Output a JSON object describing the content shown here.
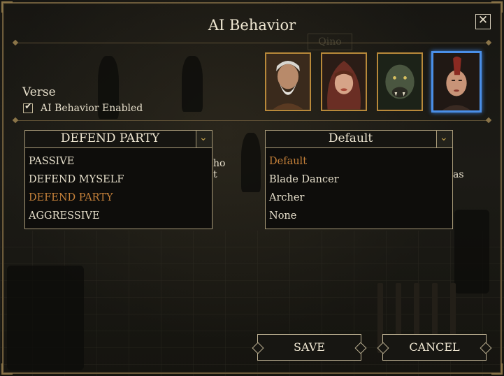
{
  "dialog": {
    "title": "AI Behavior",
    "close_label": "✕"
  },
  "background": {
    "sign_text": "Qino",
    "left_fragment": "ho\nt",
    "right_fragment": "as"
  },
  "character": {
    "name": "Verse",
    "ai_enabled_checked": true,
    "checkbox_glyph": "✔",
    "ai_enabled_label": "AI Behavior Enabled"
  },
  "portraits": [
    {
      "name": "elder-portrait",
      "selected": false
    },
    {
      "name": "hooded-portrait",
      "selected": false
    },
    {
      "name": "beast-portrait",
      "selected": false
    },
    {
      "name": "mohawk-portrait",
      "selected": true
    }
  ],
  "behavior_dropdown": {
    "selected": "DEFEND PARTY",
    "arrow": "⌄",
    "options": [
      "PASSIVE",
      "DEFEND MYSELF",
      "DEFEND PARTY",
      "AGGRESSIVE"
    ],
    "active_index": 2
  },
  "role_dropdown": {
    "selected": "Default",
    "arrow": "⌄",
    "options": [
      "Default",
      "Blade Dancer",
      "Archer",
      "None"
    ],
    "active_index": 0
  },
  "buttons": {
    "save": "SAVE",
    "cancel": "CANCEL"
  },
  "colors": {
    "accent_gold": "#b8893a",
    "active_option": "#c7823a",
    "selected_portrait": "#4a8fe8"
  }
}
